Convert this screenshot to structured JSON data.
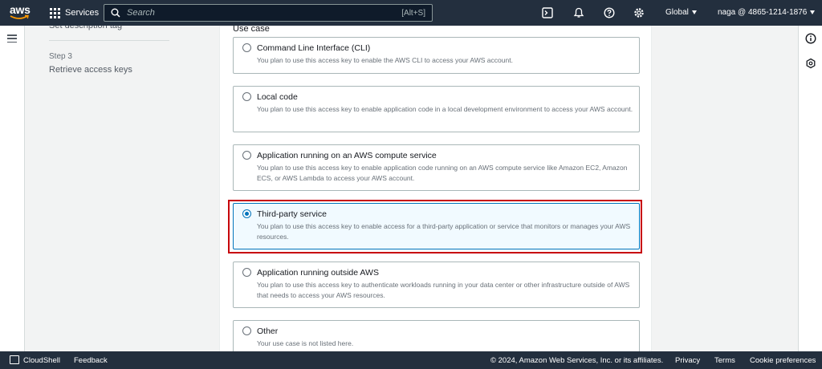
{
  "topnav": {
    "logo_text": "aws",
    "services_label": "Services",
    "search_placeholder": "Search",
    "search_shortcut": "[Alt+S]",
    "region_label": "Global",
    "account_label": "naga @ 4865-1214-1876",
    "icons": [
      "cloudshell-icon",
      "bell-icon",
      "help-icon",
      "gear-icon"
    ]
  },
  "steps": {
    "partial_prev": "Set description tag",
    "step3_label": "Step 3",
    "step3_title": "Retrieve access keys"
  },
  "main": {
    "section_label": "Use case",
    "options": [
      {
        "title": "Command Line Interface (CLI)",
        "desc": "You plan to use this access key to enable the AWS CLI to access your AWS account.",
        "selected": false
      },
      {
        "title": "Local code",
        "desc": "You plan to use this access key to enable application code in a local development environment to access your AWS account.",
        "selected": false
      },
      {
        "title": "Application running on an AWS compute service",
        "desc": "You plan to use this access key to enable application code running on an AWS compute service like Amazon EC2, Amazon ECS, or AWS Lambda to access your AWS account.",
        "selected": false
      },
      {
        "title": "Third-party service",
        "desc": "You plan to use this access key to enable access for a third-party application or service that monitors or manages your AWS resources.",
        "selected": true
      },
      {
        "title": "Application running outside AWS",
        "desc": "You plan to use this access key to authenticate workloads running in your data center or other infrastructure outside of AWS that needs to access your AWS resources.",
        "selected": false
      },
      {
        "title": "Other",
        "desc": "Your use case is not listed here.",
        "selected": false
      }
    ]
  },
  "footer": {
    "cloudshell": "CloudShell",
    "feedback": "Feedback",
    "copyright": "© 2024, Amazon Web Services, Inc. or its affiliates.",
    "privacy": "Privacy",
    "terms": "Terms",
    "cookies": "Cookie preferences"
  },
  "colors": {
    "nav_bg": "#232f3e",
    "selected_border": "#0073bb",
    "selected_bg": "#f1faff",
    "highlight": "#c7000b"
  }
}
